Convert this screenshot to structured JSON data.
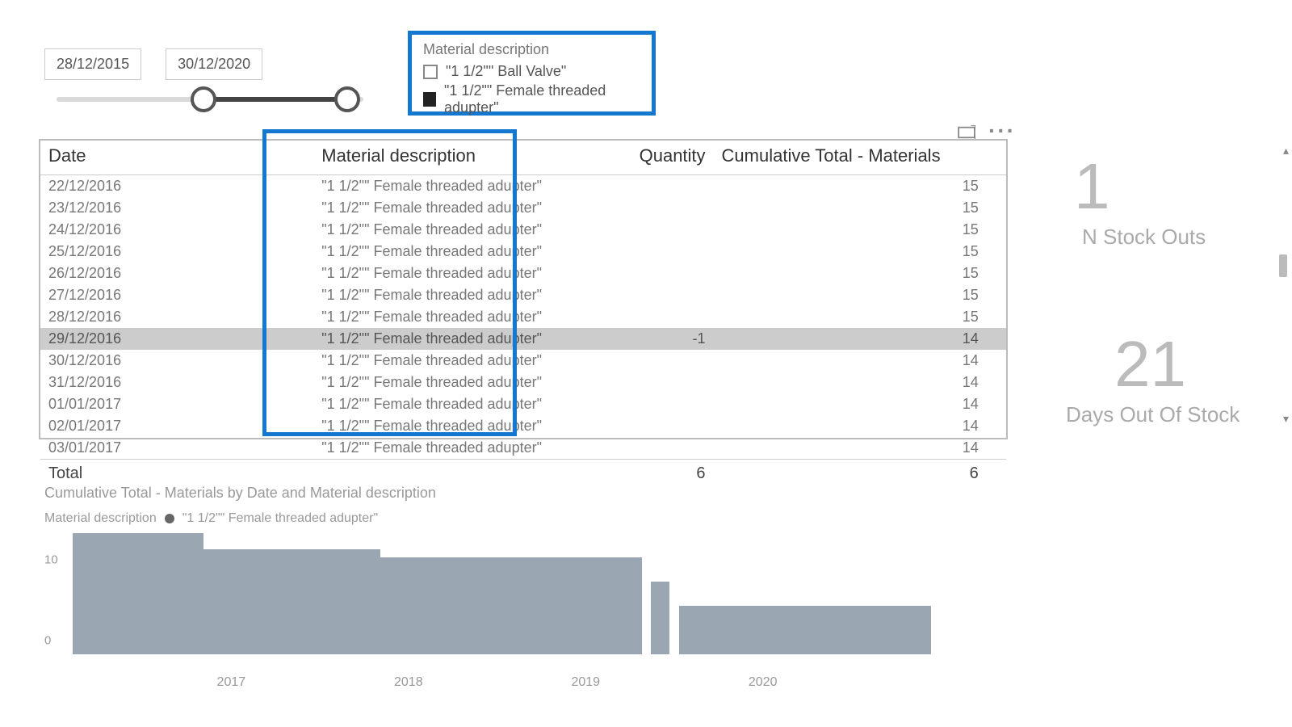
{
  "date_filter": {
    "from": "28/12/2015",
    "to": "30/12/2020"
  },
  "slicer": {
    "title": "Material description",
    "items": [
      {
        "label": "\"1 1/2\"\" Ball Valve\"",
        "checked": false
      },
      {
        "label": "\"1 1/2\"\" Female threaded adupter\"",
        "checked": true
      }
    ]
  },
  "table": {
    "columns": [
      "Date",
      "Material description",
      "Quantity",
      "Cumulative Total - Materials"
    ],
    "rows": [
      {
        "date": "22/12/2016",
        "mat": "\"1 1/2\"\" Female threaded adupter\"",
        "qty": "",
        "cum": "15"
      },
      {
        "date": "23/12/2016",
        "mat": "\"1 1/2\"\" Female threaded adupter\"",
        "qty": "",
        "cum": "15"
      },
      {
        "date": "24/12/2016",
        "mat": "\"1 1/2\"\" Female threaded adupter\"",
        "qty": "",
        "cum": "15"
      },
      {
        "date": "25/12/2016",
        "mat": "\"1 1/2\"\" Female threaded adupter\"",
        "qty": "",
        "cum": "15"
      },
      {
        "date": "26/12/2016",
        "mat": "\"1 1/2\"\" Female threaded adupter\"",
        "qty": "",
        "cum": "15"
      },
      {
        "date": "27/12/2016",
        "mat": "\"1 1/2\"\" Female threaded adupter\"",
        "qty": "",
        "cum": "15"
      },
      {
        "date": "28/12/2016",
        "mat": "\"1 1/2\"\" Female threaded adupter\"",
        "qty": "",
        "cum": "15"
      },
      {
        "date": "29/12/2016",
        "mat": "\"1 1/2\"\" Female threaded adupter\"",
        "qty": "-1",
        "cum": "14",
        "selected": true
      },
      {
        "date": "30/12/2016",
        "mat": "\"1 1/2\"\" Female threaded adupter\"",
        "qty": "",
        "cum": "14"
      },
      {
        "date": "31/12/2016",
        "mat": "\"1 1/2\"\" Female threaded adupter\"",
        "qty": "",
        "cum": "14"
      },
      {
        "date": "01/01/2017",
        "mat": "\"1 1/2\"\" Female threaded adupter\"",
        "qty": "",
        "cum": "14"
      },
      {
        "date": "02/01/2017",
        "mat": "\"1 1/2\"\" Female threaded adupter\"",
        "qty": "",
        "cum": "14"
      },
      {
        "date": "03/01/2017",
        "mat": "\"1 1/2\"\" Female threaded adupter\"",
        "qty": "",
        "cum": "14"
      }
    ],
    "total_label": "Total",
    "total_qty": "6",
    "total_cum": "6"
  },
  "kpis": {
    "k1_val": "1",
    "k1_label": "N Stock Outs",
    "k2_val": "21",
    "k2_label": "Days Out Of Stock"
  },
  "chart_data": {
    "type": "area",
    "title": "Cumulative Total - Materials by Date and Material description",
    "legend_title": "Material description",
    "series": [
      {
        "name": "\"1 1/2\"\" Female threaded adupter\"",
        "segments": [
          {
            "x_start": 0.0,
            "x_end": 0.14,
            "value": 15
          },
          {
            "x_start": 0.14,
            "x_end": 0.33,
            "value": 13
          },
          {
            "x_start": 0.33,
            "x_end": 0.61,
            "value": 12
          },
          {
            "x_start": 0.61,
            "x_end": 0.62,
            "value": 0
          },
          {
            "x_start": 0.62,
            "x_end": 0.64,
            "value": 9
          },
          {
            "x_start": 0.64,
            "x_end": 0.65,
            "value": 0
          },
          {
            "x_start": 0.65,
            "x_end": 0.92,
            "value": 6
          }
        ]
      }
    ],
    "y_ticks": [
      0,
      10
    ],
    "x_ticks": [
      "2017",
      "2018",
      "2019",
      "2020"
    ],
    "x_tick_pos": [
      0.17,
      0.36,
      0.55,
      0.74
    ],
    "ylim": [
      0,
      15
    ]
  }
}
